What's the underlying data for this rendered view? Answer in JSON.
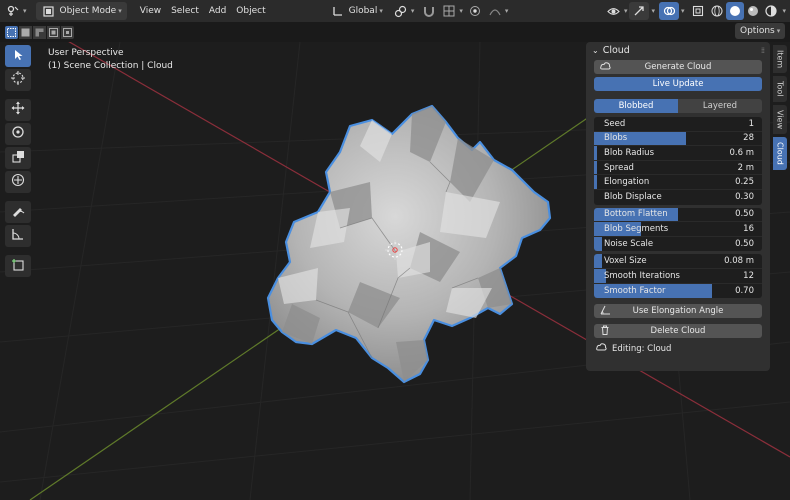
{
  "header": {
    "mode": "Object Mode",
    "menus": [
      "View",
      "Select",
      "Add",
      "Object"
    ],
    "transform_orientation": "Global"
  },
  "options_label": "Options",
  "viewport": {
    "perspective": "User Perspective",
    "collection": "(1) Scene Collection | Cloud"
  },
  "side_tabs": [
    "Item",
    "Tool",
    "View",
    "Cloud"
  ],
  "panel": {
    "title": "Cloud",
    "generate_label": "Generate Cloud",
    "live_update_label": "Live Update",
    "tabs": [
      "Blobbed",
      "Layered"
    ],
    "group1": [
      {
        "label": "Seed",
        "value": "1",
        "fill": 0
      },
      {
        "label": "Blobs",
        "value": "28",
        "fill": 0.55
      },
      {
        "label": "Blob Radius",
        "value": "0.6 m",
        "fill": 0.02
      },
      {
        "label": "Spread",
        "value": "2 m",
        "fill": 0.02
      },
      {
        "label": "Elongation",
        "value": "0.25",
        "fill": 0.02
      },
      {
        "label": "Blob Displace",
        "value": "0.30",
        "fill": 0
      }
    ],
    "group2": [
      {
        "label": "Bottom Flatten",
        "value": "0.50",
        "fill": 0.5
      },
      {
        "label": "Blob Segments",
        "value": "16",
        "fill": 0.28
      },
      {
        "label": "Noise Scale",
        "value": "0.50",
        "fill": 0.05
      }
    ],
    "group3": [
      {
        "label": "Voxel Size",
        "value": "0.08 m",
        "fill": 0.05
      },
      {
        "label": "Smooth Iterations",
        "value": "12",
        "fill": 0.07
      },
      {
        "label": "Smooth Factor",
        "value": "0.70",
        "fill": 0.7
      }
    ],
    "elongation_angle_label": "Use Elongation Angle",
    "delete_label": "Delete Cloud",
    "editing_label": "Editing: Cloud"
  }
}
